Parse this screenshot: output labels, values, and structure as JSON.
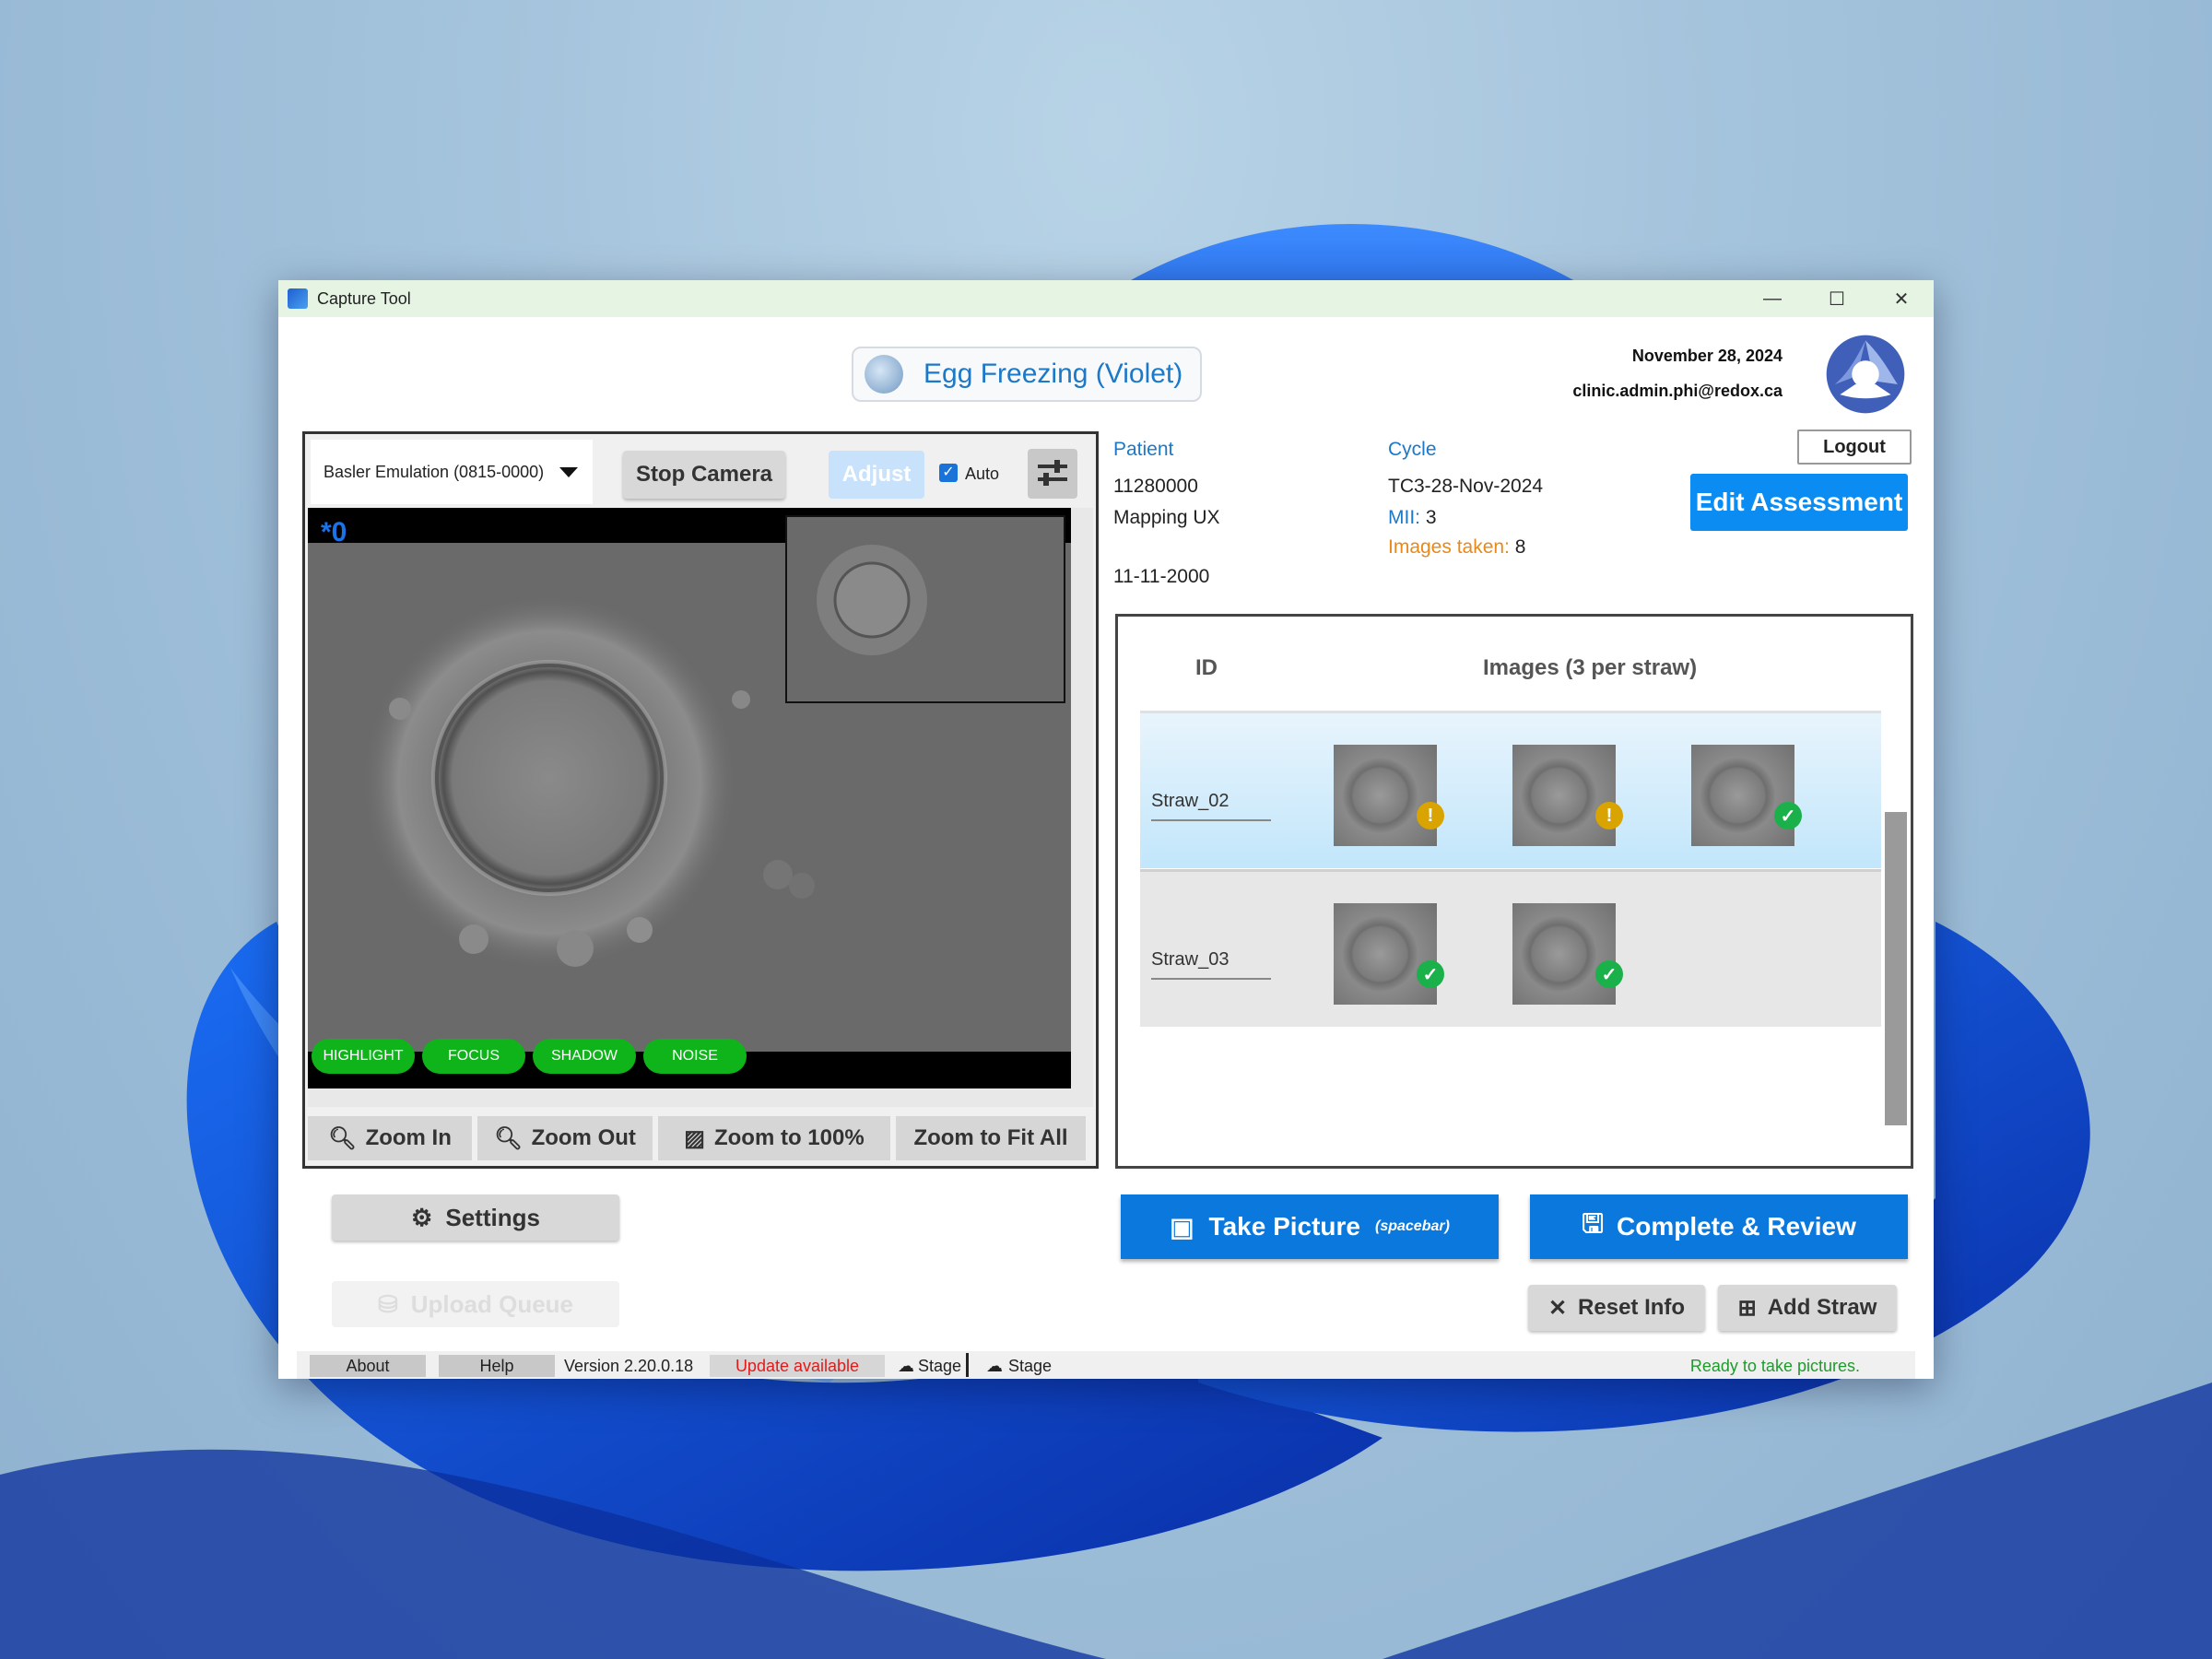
{
  "window": {
    "title": "Capture Tool",
    "controls": [
      "—",
      "☐",
      "✕"
    ]
  },
  "header": {
    "title": "Egg Freezing (Violet)"
  },
  "user": {
    "date": "November 28, 2024",
    "email": "clinic.admin.phi@redox.ca",
    "logout_label": "Logout"
  },
  "camera": {
    "device": "Basler Emulation (0815-0000)",
    "stop_label": "Stop Camera",
    "adjust_label": "Adjust",
    "auto_label": "Auto",
    "auto_checked": true,
    "overlay_label": "*0",
    "filters": [
      "HIGHLIGHT",
      "FOCUS",
      "SHADOW",
      "NOISE"
    ],
    "zoom_buttons": [
      "Zoom In",
      "Zoom Out",
      "Zoom to 100%",
      "Zoom to Fit All"
    ]
  },
  "left_actions": {
    "settings_label": "Settings",
    "upload_label": "Upload Queue"
  },
  "patient": {
    "heading": "Patient",
    "id": "11280000",
    "name": "Mapping UX",
    "dob": "11-11-2000"
  },
  "cycle": {
    "heading": "Cycle",
    "id": "TC3-28-Nov-2024",
    "mii_label": "MII:",
    "mii_value": "3",
    "images_label": "Images taken:",
    "images_value": "8"
  },
  "edit_assessment_label": "Edit Assessment",
  "straw_table": {
    "col_id": "ID",
    "col_images": "Images (3 per straw)",
    "rows": [
      {
        "id": "Straw_02",
        "images": [
          "warning",
          "warning",
          "ok"
        ]
      },
      {
        "id": "Straw_03",
        "images": [
          "ok",
          "ok"
        ]
      }
    ]
  },
  "actions": {
    "take_picture": "Take Picture",
    "take_picture_hint": "(spacebar)",
    "complete_review": "Complete & Review",
    "reset_info": "Reset Info",
    "add_straw": "Add Straw"
  },
  "statusbar": {
    "about": "About",
    "help": "Help",
    "version": "Version 2.20.0.18",
    "update": "Update available",
    "stage1": "Stage",
    "stage2": "Stage",
    "ready": "Ready to take pictures."
  },
  "colors": {
    "accent": "#0a78dd",
    "filter_green": "#0fb41b",
    "warning": "#d9a300",
    "ok": "#1bb14a",
    "update_red": "#e01b1b"
  }
}
